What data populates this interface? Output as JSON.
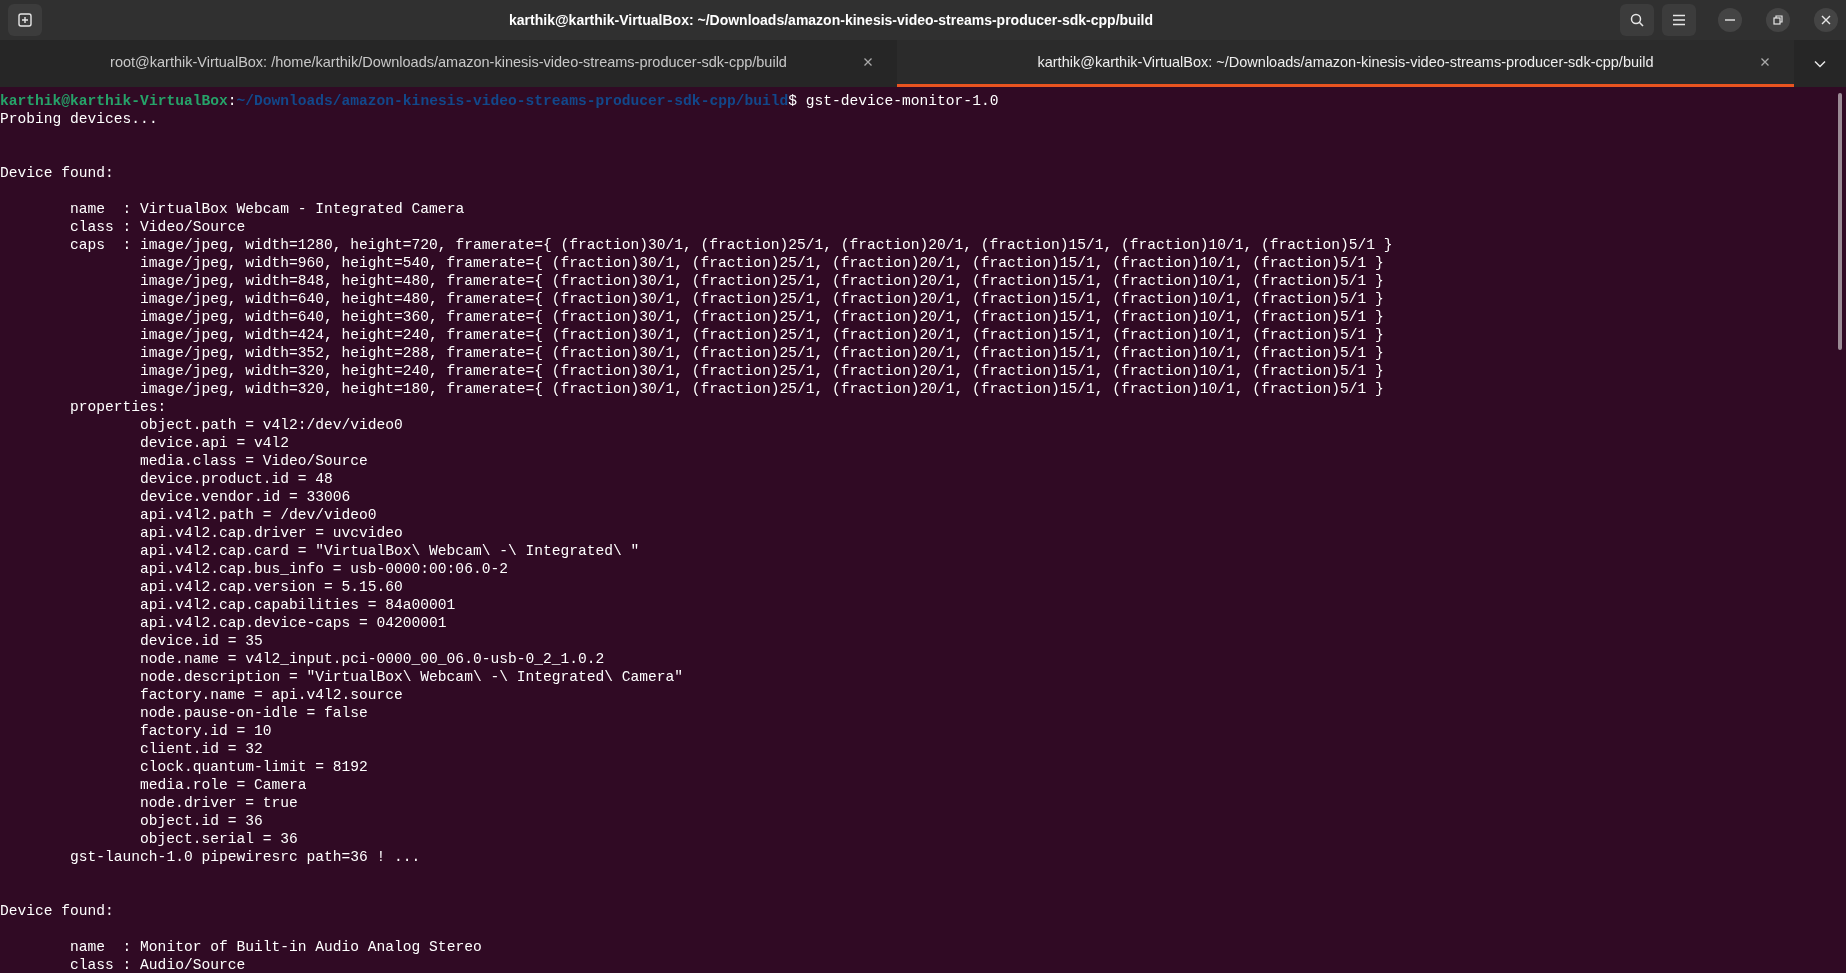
{
  "window": {
    "title": "karthik@karthik-VirtualBox: ~/Downloads/amazon-kinesis-video-streams-producer-sdk-cpp/build"
  },
  "tabs": [
    {
      "label": "root@karthik-VirtualBox: /home/karthik/Downloads/amazon-kinesis-video-streams-producer-sdk-cpp/build",
      "selected": false
    },
    {
      "label": "karthik@karthik-VirtualBox: ~/Downloads/amazon-kinesis-video-streams-producer-sdk-cpp/build",
      "selected": true
    }
  ],
  "terminal": {
    "prompt": {
      "user_host": "karthik@karthik-VirtualBox",
      "separator": ":",
      "path": "~/Downloads/amazon-kinesis-video-streams-producer-sdk-cpp/build",
      "symbol": "$",
      "command": "gst-device-monitor-1.0"
    },
    "probe_message": "Probing devices...",
    "devices": [
      {
        "heading": "Device found:",
        "entries": [
          {
            "text": "name  : VirtualBox Webcam - Integrated Camera"
          },
          {
            "text": "class : Video/Source"
          },
          {
            "text": "caps  : image/jpeg, width=1280, height=720, framerate={ (fraction)30/1, (fraction)25/1, (fraction)20/1, (fraction)15/1, (fraction)10/1, (fraction)5/1 }",
            "children": [
              {
                "text": "image/jpeg, width=960, height=540, framerate={ (fraction)30/1, (fraction)25/1, (fraction)20/1, (fraction)15/1, (fraction)10/1, (fraction)5/1 }"
              },
              {
                "text": "image/jpeg, width=848, height=480, framerate={ (fraction)30/1, (fraction)25/1, (fraction)20/1, (fraction)15/1, (fraction)10/1, (fraction)5/1 }"
              },
              {
                "text": "image/jpeg, width=640, height=480, framerate={ (fraction)30/1, (fraction)25/1, (fraction)20/1, (fraction)15/1, (fraction)10/1, (fraction)5/1 }"
              },
              {
                "text": "image/jpeg, width=640, height=360, framerate={ (fraction)30/1, (fraction)25/1, (fraction)20/1, (fraction)15/1, (fraction)10/1, (fraction)5/1 }"
              },
              {
                "text": "image/jpeg, width=424, height=240, framerate={ (fraction)30/1, (fraction)25/1, (fraction)20/1, (fraction)15/1, (fraction)10/1, (fraction)5/1 }"
              },
              {
                "text": "image/jpeg, width=352, height=288, framerate={ (fraction)30/1, (fraction)25/1, (fraction)20/1, (fraction)15/1, (fraction)10/1, (fraction)5/1 }"
              },
              {
                "text": "image/jpeg, width=320, height=240, framerate={ (fraction)30/1, (fraction)25/1, (fraction)20/1, (fraction)15/1, (fraction)10/1, (fraction)5/1 }"
              },
              {
                "text": "image/jpeg, width=320, height=180, framerate={ (fraction)30/1, (fraction)25/1, (fraction)20/1, (fraction)15/1, (fraction)10/1, (fraction)5/1 }"
              }
            ]
          },
          {
            "text": "properties:",
            "children": [
              {
                "text": "object.path = v4l2:/dev/video0"
              },
              {
                "text": "device.api = v4l2"
              },
              {
                "text": "media.class = Video/Source"
              },
              {
                "text": "device.product.id = 48"
              },
              {
                "text": "device.vendor.id = 33006"
              },
              {
                "text": "api.v4l2.path = /dev/video0"
              },
              {
                "text": "api.v4l2.cap.driver = uvcvideo"
              },
              {
                "text": "api.v4l2.cap.card = \"VirtualBox\\ Webcam\\ -\\ Integrated\\ \""
              },
              {
                "text": "api.v4l2.cap.bus_info = usb-0000:00:06.0-2"
              },
              {
                "text": "api.v4l2.cap.version = 5.15.60"
              },
              {
                "text": "api.v4l2.cap.capabilities = 84a00001"
              },
              {
                "text": "api.v4l2.cap.device-caps = 04200001"
              },
              {
                "text": "device.id = 35"
              },
              {
                "text": "node.name = v4l2_input.pci-0000_00_06.0-usb-0_2_1.0.2"
              },
              {
                "text": "node.description = \"VirtualBox\\ Webcam\\ -\\ Integrated\\ Camera\""
              },
              {
                "text": "factory.name = api.v4l2.source"
              },
              {
                "text": "node.pause-on-idle = false"
              },
              {
                "text": "factory.id = 10"
              },
              {
                "text": "client.id = 32"
              },
              {
                "text": "clock.quantum-limit = 8192"
              },
              {
                "text": "media.role = Camera"
              },
              {
                "text": "node.driver = true"
              },
              {
                "text": "object.id = 36"
              },
              {
                "text": "object.serial = 36"
              }
            ]
          },
          {
            "text": "gst-launch-1.0 pipewiresrc path=36 ! ..."
          }
        ]
      },
      {
        "heading": "Device found:",
        "entries": [
          {
            "text": "name  : Monitor of Built-in Audio Analog Stereo"
          },
          {
            "text": "class : Audio/Source"
          }
        ]
      }
    ]
  }
}
